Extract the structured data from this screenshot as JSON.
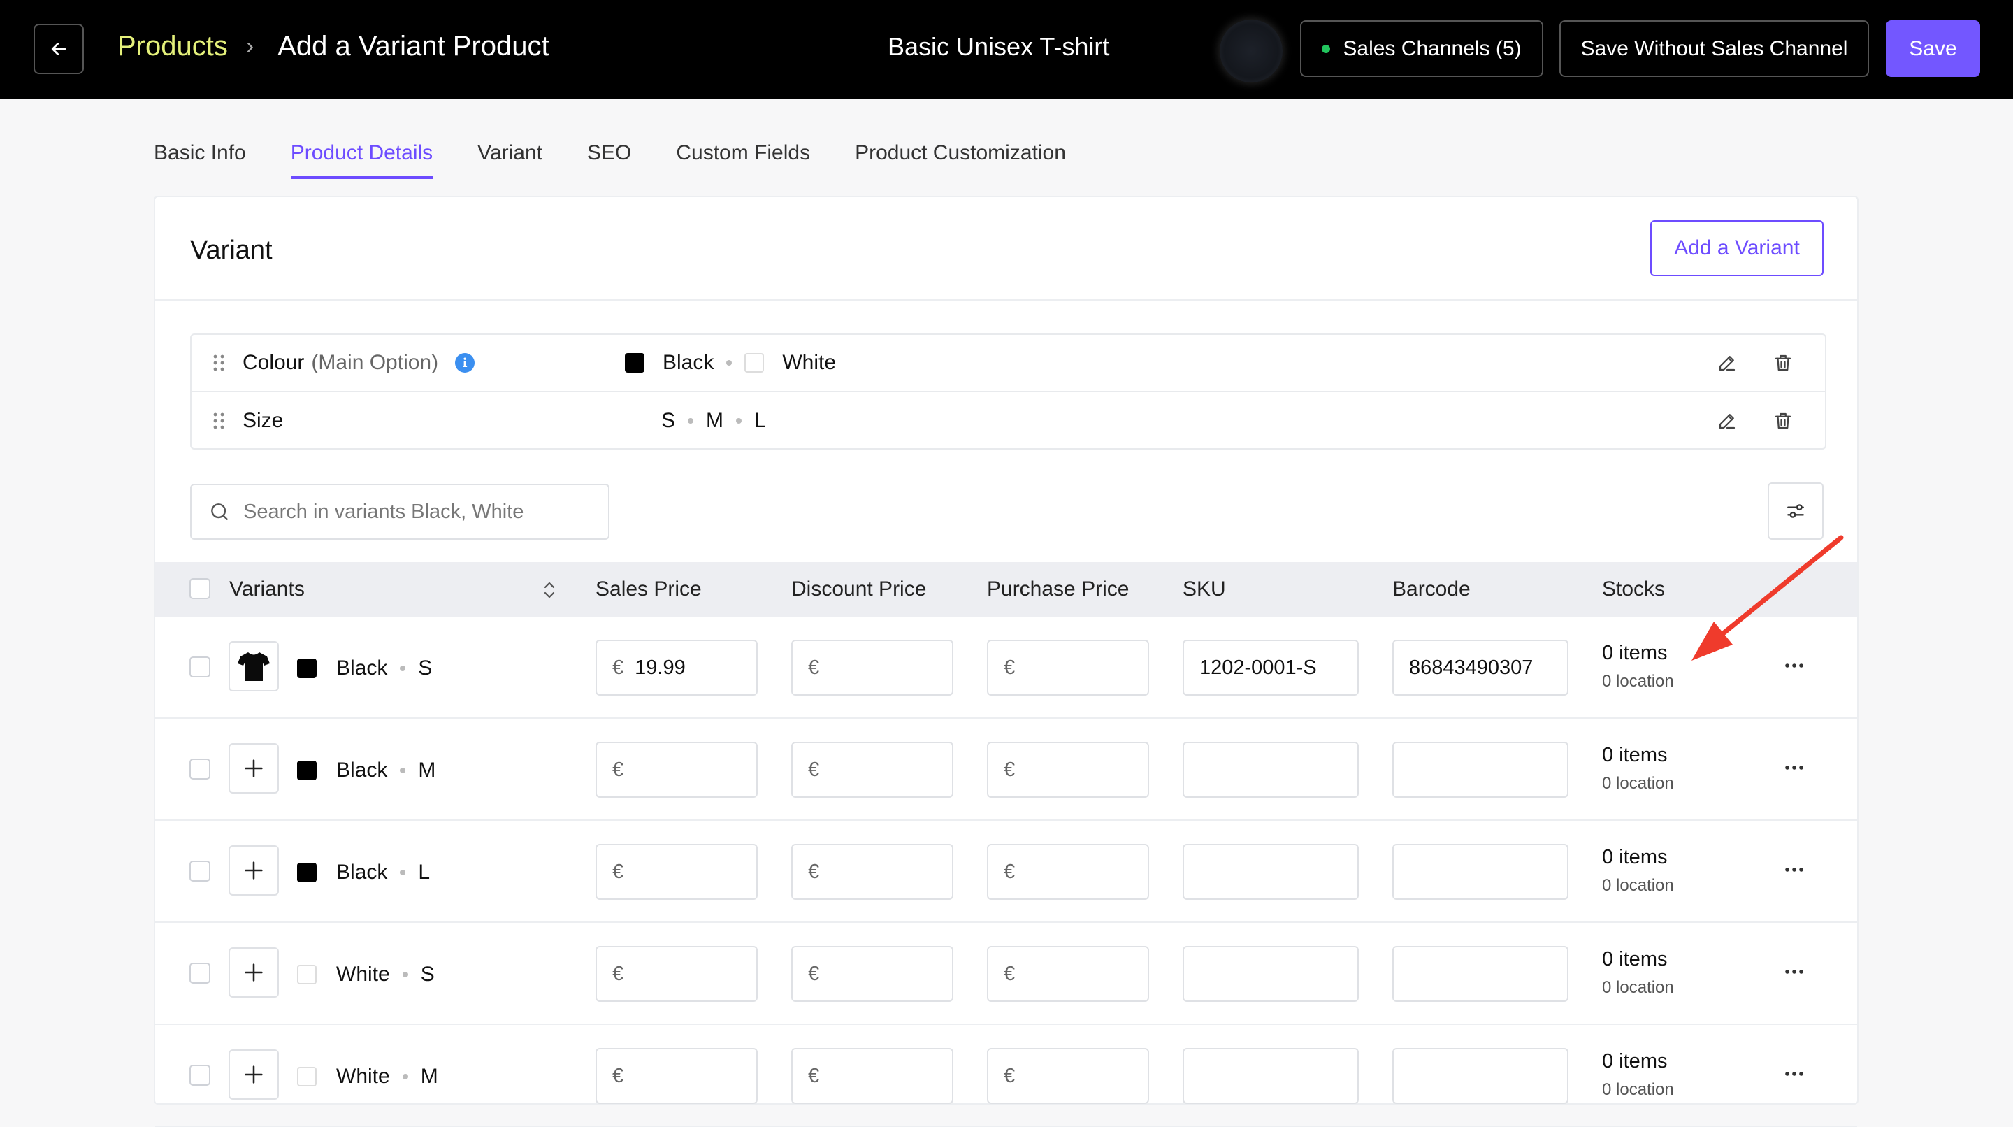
{
  "header": {
    "breadcrumb_link": "Products",
    "breadcrumb_current": "Add a Variant Product",
    "product_title": "Basic Unisex T-shirt",
    "sales_channels_label": "Sales Channels (5)",
    "save_without_label": "Save Without Sales Channel",
    "save_label": "Save"
  },
  "tabs": [
    {
      "label": "Basic Info",
      "active": false
    },
    {
      "label": "Product Details",
      "active": true
    },
    {
      "label": "Variant",
      "active": false
    },
    {
      "label": "SEO",
      "active": false
    },
    {
      "label": "Custom Fields",
      "active": false
    },
    {
      "label": "Product Customization",
      "active": false
    }
  ],
  "card": {
    "title": "Variant",
    "add_variant_label": "Add a Variant"
  },
  "options": [
    {
      "name": "Colour",
      "note": "(Main Option)",
      "values": [
        "Black",
        "White"
      ]
    },
    {
      "name": "Size",
      "values": [
        "S",
        "M",
        "L"
      ]
    }
  ],
  "search": {
    "placeholder": "Search in variants Black, White"
  },
  "table": {
    "headers": [
      "Variants",
      "Sales Price",
      "Discount Price",
      "Purchase Price",
      "SKU",
      "Barcode",
      "Stocks"
    ],
    "currency": "€",
    "rows": [
      {
        "colour": "Black",
        "size": "S",
        "swatch": "#000000",
        "has_image": true,
        "sales_price": "19.99",
        "discount_price": "",
        "purchase_price": "",
        "sku": "1202-0001-S",
        "barcode": "86843490307",
        "items": "0 items",
        "location": "0 location"
      },
      {
        "colour": "Black",
        "size": "M",
        "swatch": "#000000",
        "has_image": false,
        "sales_price": "",
        "discount_price": "",
        "purchase_price": "",
        "sku": "",
        "barcode": "",
        "items": "0 items",
        "location": "0 location"
      },
      {
        "colour": "Black",
        "size": "L",
        "swatch": "#000000",
        "has_image": false,
        "sales_price": "",
        "discount_price": "",
        "purchase_price": "",
        "sku": "",
        "barcode": "",
        "items": "0 items",
        "location": "0 location"
      },
      {
        "colour": "White",
        "size": "S",
        "swatch": "#ffffff",
        "has_image": false,
        "sales_price": "",
        "discount_price": "",
        "purchase_price": "",
        "sku": "",
        "barcode": "",
        "items": "0 items",
        "location": "0 location"
      },
      {
        "colour": "White",
        "size": "M",
        "swatch": "#ffffff",
        "has_image": false,
        "sales_price": "",
        "discount_price": "",
        "purchase_price": "",
        "sku": "",
        "barcode": "",
        "items": "0 items",
        "location": "0 location"
      }
    ]
  },
  "colors": {
    "accent": "#6d4cff",
    "breadcrumb_link": "#e4f07a",
    "annotation_arrow": "#ef3b2c"
  }
}
